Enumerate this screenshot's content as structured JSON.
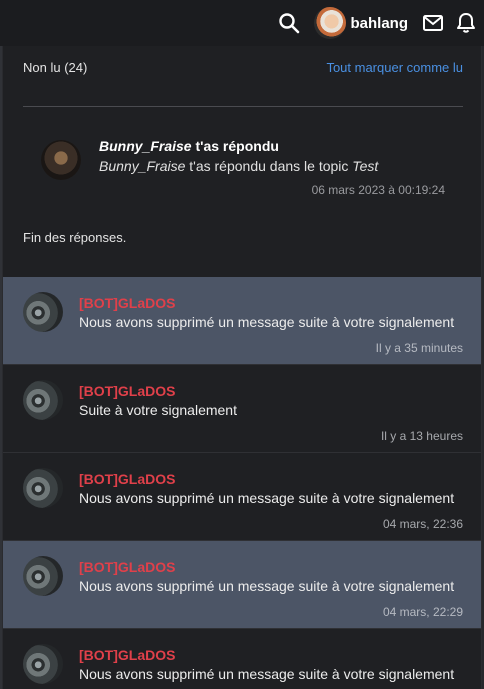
{
  "topbar": {
    "username": "bahlang",
    "icons": [
      "search-icon",
      "user-avatar",
      "mail-icon",
      "bell-icon"
    ]
  },
  "panel": {
    "filter_label": "Non lu (24)",
    "mark_all_label": "Tout marquer comme lu",
    "reply": {
      "author": "Bunny_Fraise",
      "title_suffix": " t'as répondu",
      "body_author": "Bunny_Fraise",
      "body_middle": " t'as répondu dans le topic ",
      "body_topic": "Test",
      "date": "06 mars 2023 à 00:19:24"
    },
    "end_label": "Fin des réponses.",
    "notifications": [
      {
        "author": "[BOT]GLaDOS",
        "text": "Nous avons supprimé un message suite à votre signalement",
        "time": "Il y a 35 minutes",
        "highlight": true
      },
      {
        "author": "[BOT]GLaDOS",
        "text": "Suite à votre signalement",
        "time": "Il y a 13 heures",
        "highlight": false
      },
      {
        "author": "[BOT]GLaDOS",
        "text": "Nous avons supprimé un message suite à votre signalement",
        "time": "04 mars, 22:36",
        "highlight": false
      },
      {
        "author": "[BOT]GLaDOS",
        "text": "Nous avons supprimé un message suite à votre signalement",
        "time": "04 mars, 22:29",
        "highlight": true
      },
      {
        "author": "[BOT]GLaDOS",
        "text": "Nous avons supprimé un message suite à votre signalement",
        "time": "",
        "highlight": false
      }
    ]
  },
  "colors": {
    "accent_link": "#4a90e2",
    "bot_name": "#e0404a",
    "highlight_row": "#4c5566",
    "panel_bg": "#1f2023"
  }
}
